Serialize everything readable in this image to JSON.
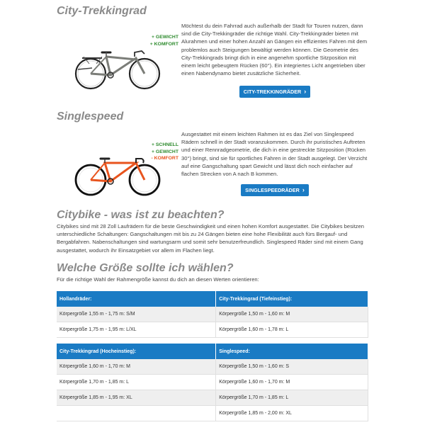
{
  "sections": {
    "city_trekking": {
      "title": "City-Trekkingrad",
      "attrs": [
        "+ GEWICHT",
        "+ KOMFORT"
      ],
      "text": "Möchtest du dein Fahrrad auch außerhalb der Stadt für Touren nutzen, dann sind die City-Trekkingräder die richtige Wahl. City-Trekkingräder bieten mit Alurahmen und einer hohen Anzahl an Gängen ein effizientes Fahren mit dem problemlos auch Steigungen bewältigt werden können. Die Geometrie des City-Trekkingrads bringt dich in eine angenehm sportliche Sitzposition mit einem leicht gebeugtem Rücken (60°). Ein integriertes Licht angetrieben über einen Nabendynamo bietet zusätzliche Sicherheit.",
      "button": "CITY-TREKKINGRÄDER"
    },
    "singlespeed": {
      "title": "Singlespeed",
      "attrs": [
        "+ SCHNELL",
        "+ GEWICHT",
        "- KOMFORT"
      ],
      "text": "Ausgestattet mit einem leichten Rahmen ist es das Ziel von Singlespeed Rädern schnell in der Stadt voranzukommen. Durch ihr puristisches Auftreten und einer Rennradgeometrie, die dich in eine gestreckte Sitzposition (Rücken 30°) bringt, sind sie für sportliches Fahren in der Stadt ausgelegt. Der Verzicht auf eine Gangschaltung spart Gewicht und lässt dich noch einfacher auf flachen Strecken von A nach B kommen.",
      "button": "SINGLESPEEDRÄDER"
    },
    "citybike": {
      "title": "Citybike - was ist zu beachten?",
      "text": "Citybikes sind mit 28 Zoll Laufrädern für die beste Geschwindigkeit und einen hohen Komfort ausgestattet. Die Citybikes besitzen unterschiedliche Schaltungen: Gangschaltungen mit bis zu 24 Gängen bieten eine hohe Flexibilität auch fürs Bergauf- und Bergabfahren. Nabenschaltungen sind wartungsarm und somit sehr benutzerfreundlich. Singlespeed Räder sind mit einem Gang ausgestattet, wodurch ihr Einsatzgebiet vor allem im Flachen liegt."
    },
    "size": {
      "title": "Welche Größe sollte ich wählen?",
      "intro": "Für die richtige Wahl der Rahmengröße kannst du dich an diesen Werten orientieren:"
    }
  },
  "table1": {
    "headers": [
      "Hollandräder:",
      "City-Trekkingrad (Tiefeinstieg):"
    ],
    "rows": [
      [
        "Körpergröße 1,55 m - 1,75 m: S/M",
        "Körpergröße 1,50 m - 1,60 m: M"
      ],
      [
        "Körpergröße 1,75 m - 1,95 m: L/XL",
        "Körpergröße 1,60 m - 1,78 m: L"
      ]
    ]
  },
  "table2": {
    "headers": [
      "City-Trekkingrad (Hocheinstieg):",
      "Singlespeed:"
    ],
    "rows": [
      [
        "Körpergröße 1,60 m - 1,70 m: M",
        "Körpergröße 1,50 m - 1,60 m: S"
      ],
      [
        "Körpergröße 1,70 m - 1,85 m: L",
        "Körpergröße 1,60 m - 1,70 m: M"
      ],
      [
        "Körpergröße 1,85 m - 1,95 m: XL",
        "Körpergröße 1,70 m - 1,85 m: L"
      ],
      [
        "",
        "Körpergröße 1,85 m - 2,00 m: XL"
      ]
    ]
  },
  "colors": {
    "accent": "#1a7bc4",
    "heading": "#8a8a8a",
    "plus": "#2e8b2e",
    "minus": "#e8541e",
    "single_frame": "#e8541e",
    "trekking_frame": "#7b7d78"
  },
  "icons": {
    "button_chevron": "chevron-right-icon"
  }
}
